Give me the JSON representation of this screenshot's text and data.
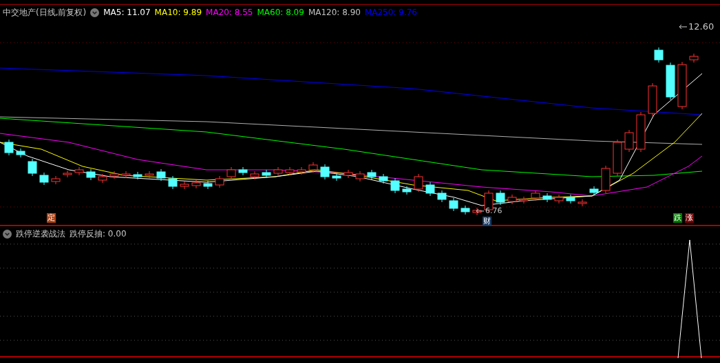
{
  "main_chart": {
    "title": "中交地产(日线,前复权)",
    "indicators": [
      {
        "label": "MA5: 11.07",
        "color": "#ffffff"
      },
      {
        "label": "MA10: 9.89",
        "color": "#ffff00"
      },
      {
        "label": "MA20: 8.55",
        "color": "#ff00ff"
      },
      {
        "label": "MA60: 8.09",
        "color": "#00ff00"
      },
      {
        "label": "MA120: 8.90",
        "color": "#c0c0c0"
      },
      {
        "label": "MA250: 9.76",
        "color": "#0000ff"
      }
    ],
    "high_label": "12.60",
    "low_label": "6.76",
    "markers": [
      {
        "text": "定",
        "color": "#b04010"
      },
      {
        "text": "财",
        "color": "#1c3c64"
      },
      {
        "text": "跌",
        "color": "#007a00"
      },
      {
        "text": "涨",
        "color": "#7a0000"
      }
    ]
  },
  "sub_chart": {
    "title": "跌停逆袭战法",
    "reading": "跌停反抽: 0.00"
  }
}
